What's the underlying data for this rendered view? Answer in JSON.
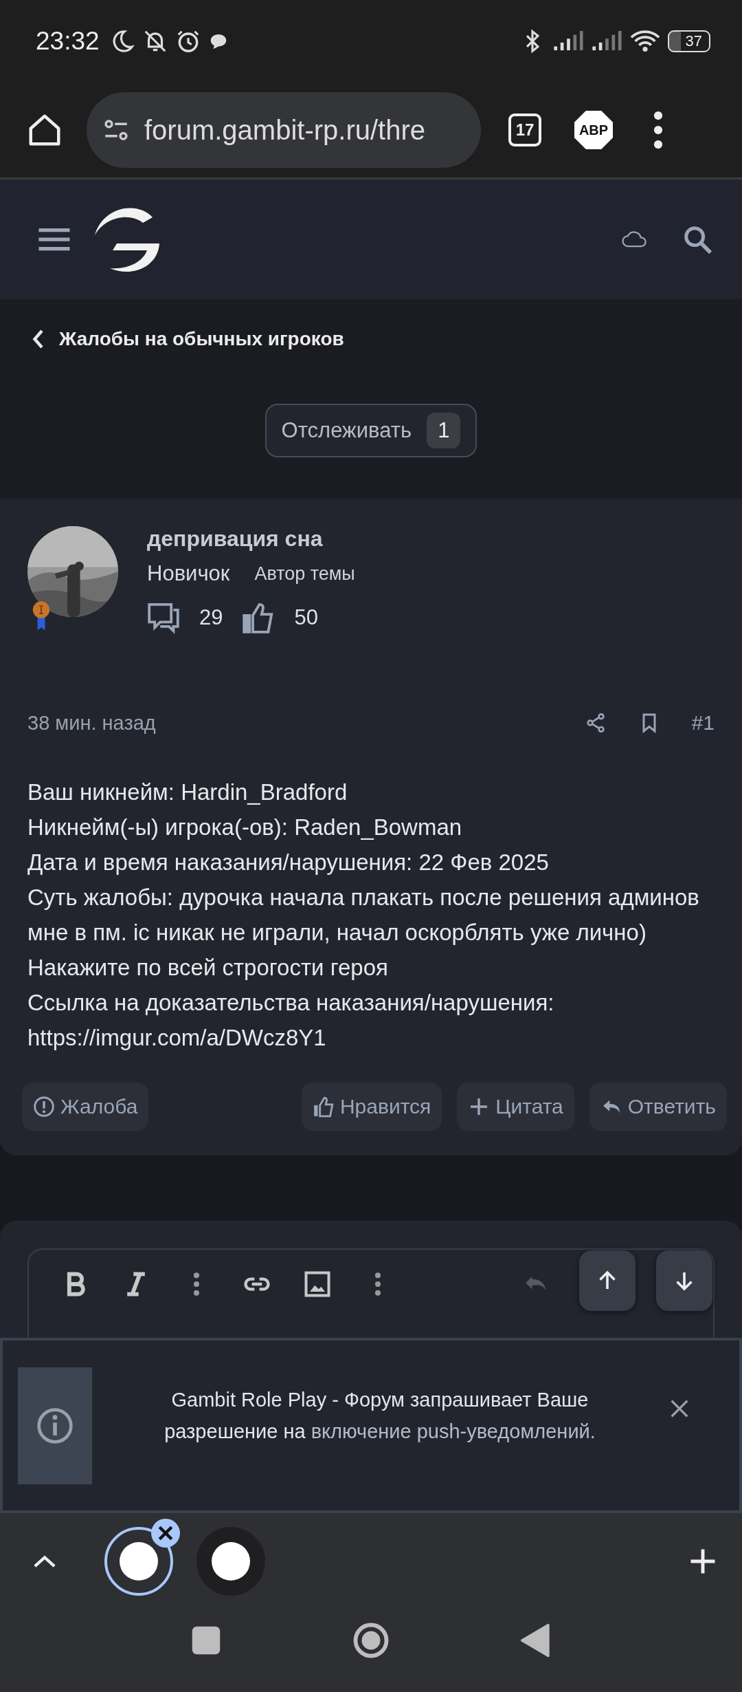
{
  "status_bar": {
    "time": "23:32",
    "battery": "37"
  },
  "browser": {
    "url": "forum.gambit-rp.ru/thre",
    "tab_count": "17",
    "adblock": "ABP"
  },
  "breadcrumb": "Жалобы на обычных игроков",
  "watch": {
    "label": "Отслеживать",
    "count": "1"
  },
  "post": {
    "author": "депривация сна",
    "rank": "Новичок",
    "role": "Автор темы",
    "messages": "29",
    "likes": "50",
    "time": "38 мин. назад",
    "number": "#1",
    "lines": [
      "Ваш никнейм: Hardin_Bradford",
      "Никнейм(-ы) игрока(-ов): Raden_Bowman",
      "Дата и время наказания/нарушения: 22 Фев 2025",
      "Суть жалобы: дурочка начала плакать после решения админов мне в пм. іс никак не играли, начал оскорблять уже лично) Накажите по всей строгости героя",
      "Ссылка на доказательства наказания/нарушения:",
      "https://imgur.com/a/DWcz8Y1"
    ],
    "actions": [
      {
        "label": "Жалоба",
        "kind": "report"
      },
      {
        "label": "Нравится",
        "kind": "like"
      },
      {
        "label": "Цитата",
        "kind": "quote"
      },
      {
        "label": "Ответить",
        "kind": "reply"
      }
    ]
  },
  "notification": {
    "text": "Gambit Role Play - Форум запрашивает Ваше разрешение на ",
    "link": "включение push-уведомлений."
  },
  "tabs": [
    {
      "selected": true
    },
    {
      "selected": false
    }
  ]
}
